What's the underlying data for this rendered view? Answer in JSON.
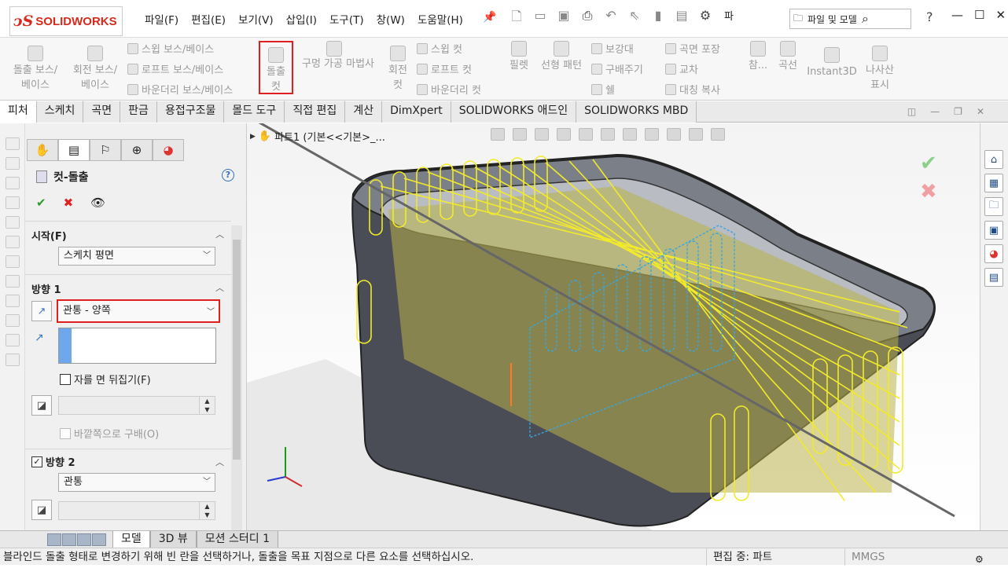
{
  "app": {
    "logo_mark": "ↄS",
    "logo_text": "SOLIDWORKS"
  },
  "menu": [
    "파일(F)",
    "편집(E)",
    "보기(V)",
    "삽입(I)",
    "도구(T)",
    "창(W)",
    "도움말(H)"
  ],
  "quickbar": {
    "label_trunc": "파",
    "search_placeholder": "파일 및 모델",
    "help": "?"
  },
  "ribbon": {
    "extrude_boss": "돌출 보스/\n베이스",
    "revolve_boss": "회전 보스/\n베이스",
    "sweep_boss": "스윕 보스/베이스",
    "loft_boss": "로프트 보스/베이스",
    "boundary_boss": "바운더리 보스/베이스",
    "extrude_cut": "돌출\n컷",
    "hole_wizard": "구멍 가공 마법사",
    "revolve_cut": "회전\n컷",
    "sweep_cut": "스윕 컷",
    "loft_cut": "로프트 컷",
    "boundary_cut": "바운더리 컷",
    "fillet": "필렛",
    "linear_pattern": "선형 패턴",
    "rib": "보강대",
    "draft": "구배주기",
    "shell": "쉘",
    "wrap": "곡면 포장",
    "intersect": "교차",
    "mirror": "대칭 복사",
    "ref": "참...",
    "curves": "곡선",
    "instant3d": "Instant3D",
    "helix": "나사산\n표시"
  },
  "command_tabs": [
    "피처",
    "스케치",
    "곡면",
    "판금",
    "용접구조물",
    "몰드 도구",
    "직접 편집",
    "계산",
    "DimXpert",
    "SOLIDWORKS 애드인",
    "SOLIDWORKS MBD"
  ],
  "property_manager": {
    "title": "컷-돌출",
    "help": "?",
    "from": {
      "header": "시작(F)",
      "value": "스케치 평면"
    },
    "direction1": {
      "header": "방향 1",
      "end_condition": "관통 - 양쪽",
      "flip_side": "자를 면 뒤집기(F)",
      "draft_outward": "바깥쪽으로 구배(O)"
    },
    "direction2": {
      "header": "방향 2",
      "checked": true,
      "end_condition": "관통"
    }
  },
  "viewport": {
    "tree_label": "파트1  (기본<<기본>_..."
  },
  "bottom_tabs": [
    "모델",
    "3D 뷰",
    "모션 스터디 1"
  ],
  "status": {
    "message": "블라인드 돌출 형태로 변경하기 위해 빈 란을 선택하거나, 돌출을 목표 지점으로 다른 요소를 선택하십시오.",
    "edit_mode": "편집 중: 파트",
    "units": "MMGS"
  }
}
